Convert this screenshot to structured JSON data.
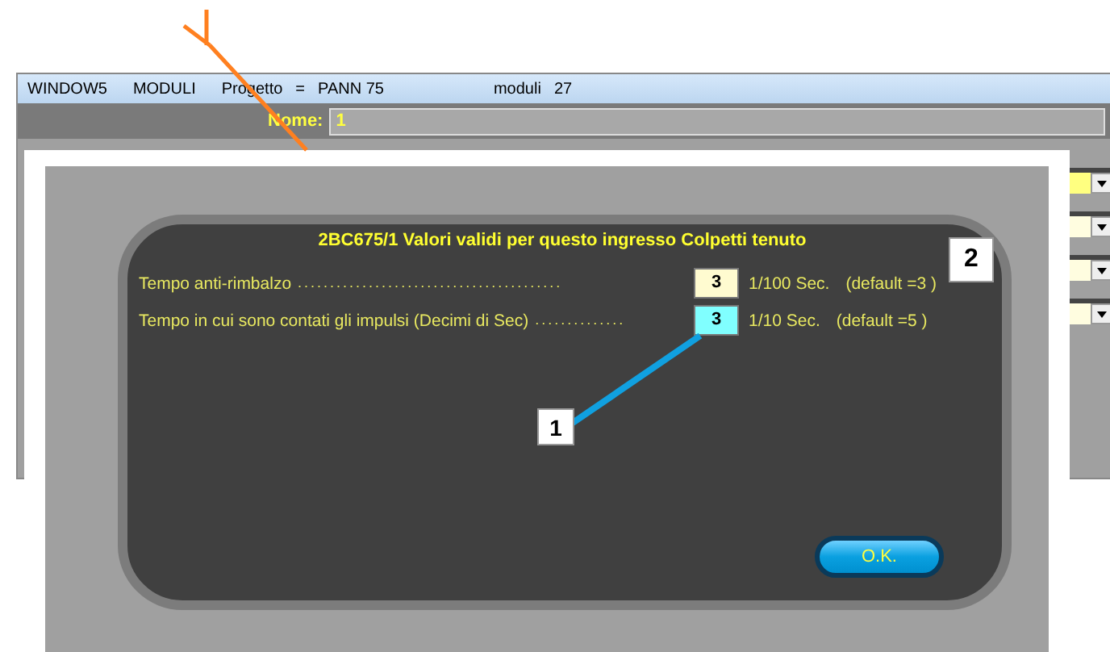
{
  "back_window": {
    "menu": [
      "WINDOW5",
      "MODULI"
    ],
    "project_label": "Progetto",
    "project_eq": "=",
    "project_value": "PANN 75",
    "modules_label": "moduli",
    "modules_value": "27",
    "name_label": "Nome:",
    "name_value": "1",
    "dropdowns": [
      {
        "highlighted": true
      },
      {
        "highlighted": false
      },
      {
        "highlighted": false
      },
      {
        "highlighted": false
      }
    ]
  },
  "dialog": {
    "title": "2BC675/1  Valori validi per questo ingresso Colpetti tenuto",
    "rows": [
      {
        "label": "Tempo anti-rimbalzo",
        "dots": ". . . . . . . . . . . . . . . . . . . . . . . . . . . . . . . . . . . . . . . . .",
        "value": "3",
        "unit": "1/100 Sec.",
        "default": "(default =3 )",
        "focused": false
      },
      {
        "label": "Tempo in cui sono contati gli impulsi  (Decimi di Sec)",
        "dots": ". . . . . . . . . . . . . .",
        "value": "3",
        "unit": "1/10 Sec.",
        "default": "(default =5 )",
        "focused": true
      }
    ],
    "ok_button": "O.K."
  },
  "callouts": [
    "1",
    "2"
  ]
}
